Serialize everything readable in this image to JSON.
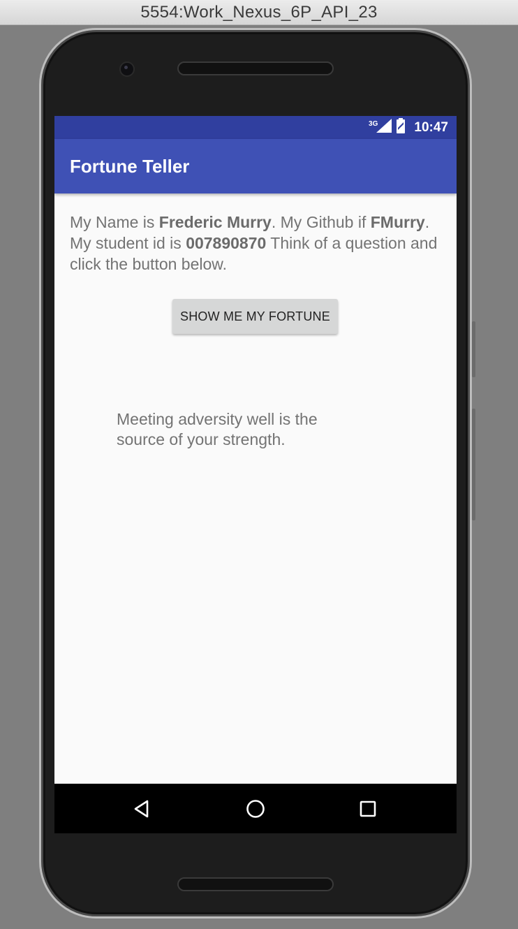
{
  "window": {
    "title": "5554:Work_Nexus_6P_API_23"
  },
  "statusbar": {
    "network": "3G",
    "time": "10:47"
  },
  "appbar": {
    "title": "Fortune Teller"
  },
  "intro": {
    "t1": "My Name is ",
    "name": "Frederic Murry",
    "t2": ". My Github if ",
    "github": "FMurry",
    "t3": ". My student id is ",
    "student_id": "007890870",
    "t4": " Think of a question and click the button below."
  },
  "button": {
    "label": "SHOW ME MY FORTUNE"
  },
  "fortune": {
    "text": "Meeting adversity well is the source of your strength."
  },
  "navbar": {
    "back": "back-icon",
    "home": "home-icon",
    "recents": "recents-icon"
  },
  "colors": {
    "status_bar": "#303f9f",
    "app_bar": "#3f51b5",
    "background": "#fafafa",
    "button": "#d6d7d7"
  }
}
